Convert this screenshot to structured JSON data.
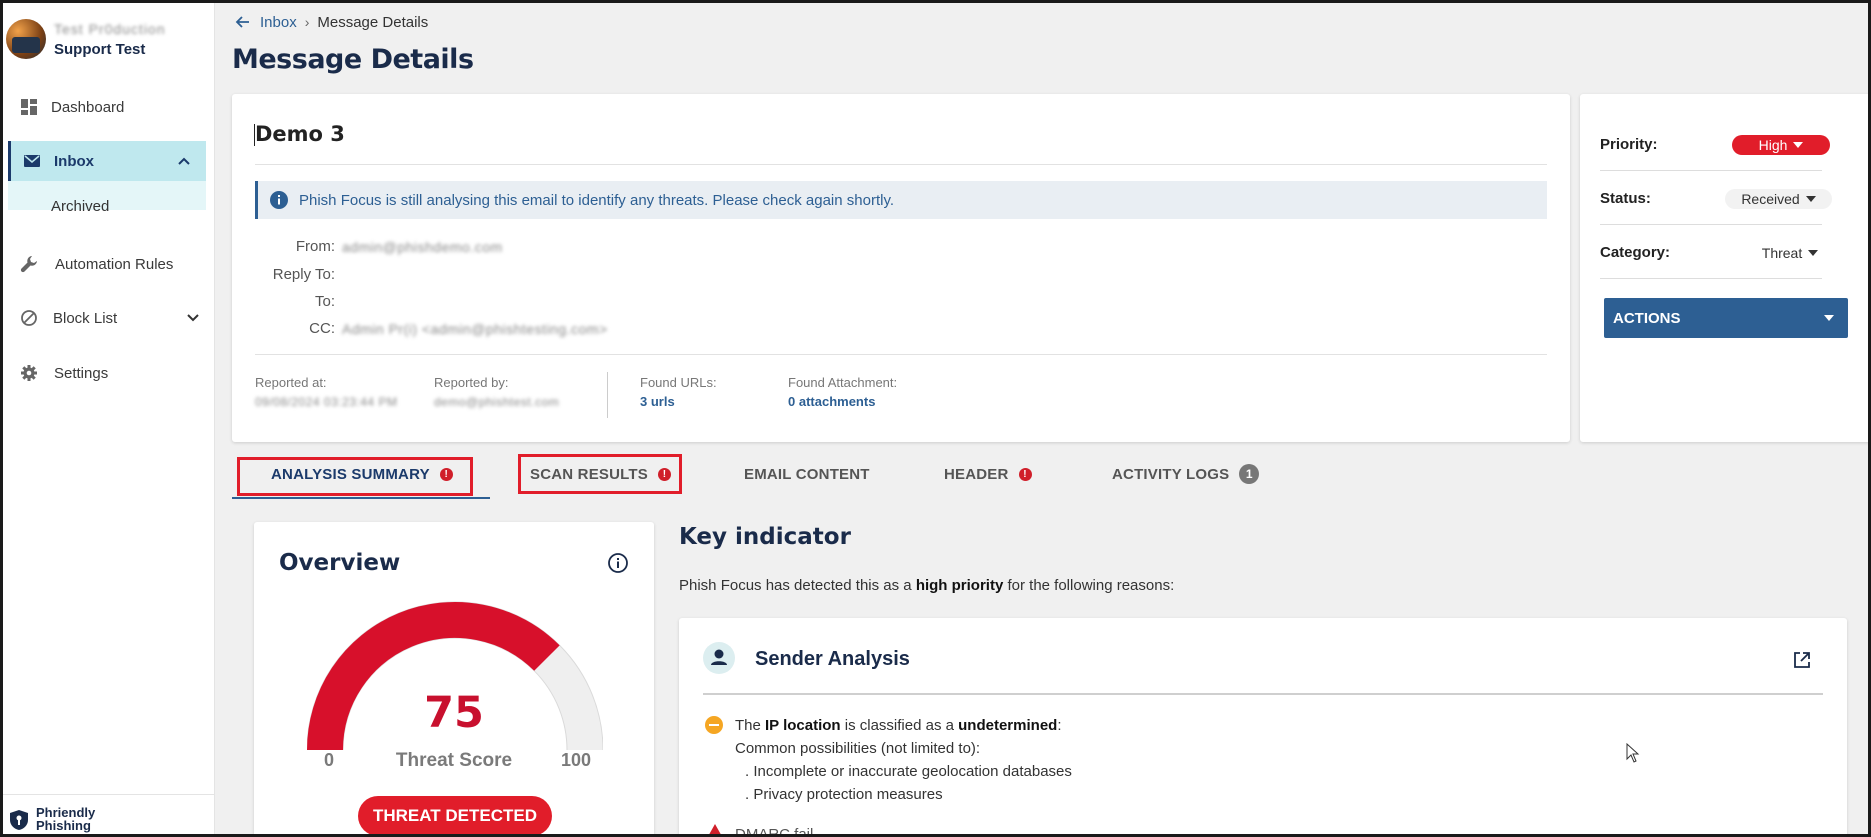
{
  "sidebar": {
    "user_name": "Test Pr0duction",
    "org_name": "Support Test",
    "nav": {
      "dashboard": "Dashboard",
      "inbox": "Inbox",
      "archived": "Archived",
      "automation": "Automation Rules",
      "blocklist": "Block List",
      "settings": "Settings"
    },
    "brand_line1": "Phriendly",
    "brand_line2": "Phishing"
  },
  "breadcrumb": {
    "parent": "Inbox",
    "current": "Message Details"
  },
  "page_title": "Message Details",
  "message": {
    "subject": "Demo 3",
    "info_notice": "Phish Focus is still analysing this email to identify any threats. Please check again shortly.",
    "labels": {
      "from": "From:",
      "reply_to": "Reply To:",
      "to": "To:",
      "cc": "CC:"
    },
    "from_value": "admin@phishdemo.com",
    "cc_value": "Admin Pr(i) <admin@phishtesting.com>",
    "meta": {
      "reported_at_label": "Reported at:",
      "reported_at_value": "09/08/2024 03:23:44 PM",
      "reported_by_label": "Reported by:",
      "reported_by_value": "demo@phishtest.com",
      "found_urls_label": "Found URLs:",
      "found_urls_value": "3 urls",
      "found_attachment_label": "Found Attachment:",
      "found_attachment_value": "0 attachments"
    }
  },
  "properties": {
    "priority_label": "Priority:",
    "priority_value": "High",
    "status_label": "Status:",
    "status_value": "Received",
    "category_label": "Category:",
    "category_value": "Threat",
    "actions_label": "ACTIONS"
  },
  "tabs": {
    "analysis": "ANALYSIS SUMMARY",
    "scan": "SCAN RESULTS",
    "email": "EMAIL CONTENT",
    "header": "HEADER",
    "activity": "ACTIVITY LOGS",
    "activity_count": "1",
    "alert_mark": "!"
  },
  "overview": {
    "title": "Overview",
    "score": "75",
    "score_fraction": 0.75,
    "score_label": "Threat Score",
    "min": "0",
    "max": "100",
    "verdict": "THREAT DETECTED"
  },
  "key_indicator": {
    "title": "Key indicator",
    "desc_prefix": "Phish Focus has detected this as a ",
    "desc_bold": "high priority",
    "desc_suffix": " for the following reasons:"
  },
  "sender_analysis": {
    "title": "Sender Analysis",
    "line1_pre": "The ",
    "line1_b1": "IP location",
    "line1_mid": " is classified as a ",
    "line1_b2": "undetermined",
    "line1_end": ":",
    "line2": "Common possibilities (not limited to):",
    "bullet1": ".   Incomplete or inaccurate geolocation databases",
    "bullet2": ".   Privacy protection measures",
    "line3": "DMARC fail"
  },
  "colors": {
    "accent": "#2d5f93",
    "danger": "#e11d2a",
    "navy": "#1a2b4a",
    "active_nav": "#bfe8ee"
  }
}
